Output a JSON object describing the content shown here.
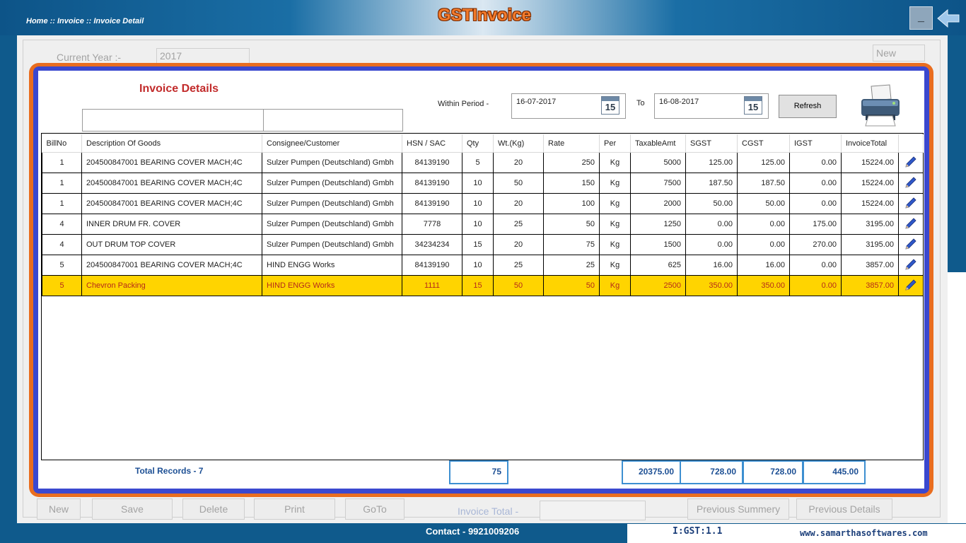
{
  "app": {
    "title": "GSTInvoice",
    "breadcrumb": "Home :: Invoice :: Invoice Detail",
    "minimize_label": "_"
  },
  "background": {
    "current_year_label": "Current Year :-",
    "current_year_value": "2017",
    "new_top_label": "New"
  },
  "invoice": {
    "title": "Invoice Details",
    "period_label": "Within Period -",
    "from_date": "16-07-2017",
    "to_label": "To",
    "to_date": "16-08-2017",
    "calendar_day": "15",
    "refresh_label": "Refresh"
  },
  "table": {
    "columns": [
      "BillNo",
      "Description Of Goods",
      "Consignee/Customer",
      "HSN / SAC",
      "Qty",
      "Wt.(Kg)",
      "Rate",
      "Per",
      "TaxableAmt",
      "SGST",
      "CGST",
      "IGST",
      "InvoiceTotal"
    ],
    "rows": [
      {
        "billno": "1",
        "desc": "204500847001 BEARING COVER MACH;4C",
        "consignee": "Sulzer Pumpen (Deutschland) Gmbh",
        "hsn": "84139190",
        "qty": "5",
        "wt": "20",
        "rate": "250",
        "per": "Kg",
        "taxable": "5000",
        "sgst": "125.00",
        "cgst": "125.00",
        "igst": "0.00",
        "total": "15224.00"
      },
      {
        "billno": "1",
        "desc": "204500847001 BEARING COVER MACH;4C",
        "consignee": "Sulzer Pumpen (Deutschland) Gmbh",
        "hsn": "84139190",
        "qty": "10",
        "wt": "50",
        "rate": "150",
        "per": "Kg",
        "taxable": "7500",
        "sgst": "187.50",
        "cgst": "187.50",
        "igst": "0.00",
        "total": "15224.00"
      },
      {
        "billno": "1",
        "desc": "204500847001 BEARING COVER MACH;4C",
        "consignee": "Sulzer Pumpen (Deutschland) Gmbh",
        "hsn": "84139190",
        "qty": "10",
        "wt": "20",
        "rate": "100",
        "per": "Kg",
        "taxable": "2000",
        "sgst": "50.00",
        "cgst": "50.00",
        "igst": "0.00",
        "total": "15224.00"
      },
      {
        "billno": "4",
        "desc": "INNER DRUM FR. COVER",
        "consignee": "Sulzer Pumpen (Deutschland) Gmbh",
        "hsn": "7778",
        "qty": "10",
        "wt": "25",
        "rate": "50",
        "per": "Kg",
        "taxable": "1250",
        "sgst": "0.00",
        "cgst": "0.00",
        "igst": "175.00",
        "total": "3195.00"
      },
      {
        "billno": "4",
        "desc": "OUT DRUM TOP COVER",
        "consignee": "Sulzer Pumpen (Deutschland) Gmbh",
        "hsn": "34234234",
        "qty": "15",
        "wt": "20",
        "rate": "75",
        "per": "Kg",
        "taxable": "1500",
        "sgst": "0.00",
        "cgst": "0.00",
        "igst": "270.00",
        "total": "3195.00"
      },
      {
        "billno": "5",
        "desc": "204500847001 BEARING COVER MACH;4C",
        "consignee": "HIND ENGG Works",
        "hsn": "84139190",
        "qty": "10",
        "wt": "25",
        "rate": "25",
        "per": "Kg",
        "taxable": "625",
        "sgst": "16.00",
        "cgst": "16.00",
        "igst": "0.00",
        "total": "3857.00"
      },
      {
        "billno": "5",
        "desc": "Chevron Packing",
        "consignee": "HIND ENGG Works",
        "hsn": "1111",
        "qty": "15",
        "wt": "50",
        "rate": "50",
        "per": "Kg",
        "taxable": "2500",
        "sgst": "350.00",
        "cgst": "350.00",
        "igst": "0.00",
        "total": "3857.00",
        "selected": true
      }
    ]
  },
  "totals": {
    "records_label": "Total Records - 7",
    "qty_total": "75",
    "taxable_total": "20375.00",
    "sgst_total": "728.00",
    "cgst_total": "728.00",
    "igst_total": "445.00"
  },
  "buttons": {
    "new": "New",
    "save": "Save",
    "delete": "Delete",
    "print": "Print",
    "goto": "GoTo",
    "invoice_total_label": "Invoice Total -",
    "previous_summery": "Previous Summery",
    "previous_details": "Previous Details"
  },
  "footer": {
    "contact": "Contact  -  9921009206",
    "version": "I:GST:1.1",
    "website": "www.samarthasoftwares.com"
  },
  "colors": {
    "accent_orange": "#e96d1f",
    "frame_blue": "#3a48cf",
    "selected_row": "#ffd400",
    "title_red": "#c22b2b"
  }
}
